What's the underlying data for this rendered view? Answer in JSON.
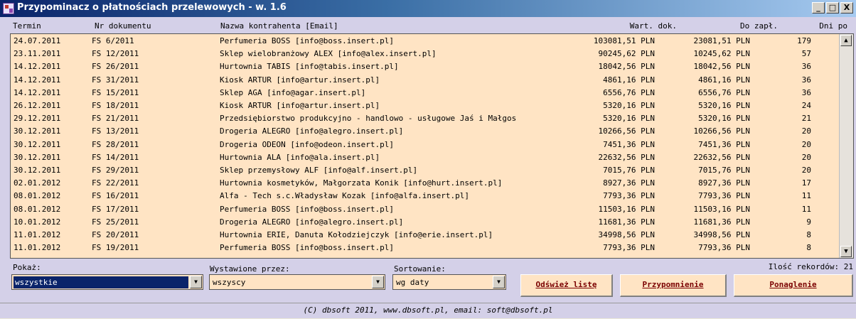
{
  "window": {
    "title": "Przypominacz o płatnościach przelewowych - w. 1.6",
    "min": "_",
    "max": "□",
    "close": "X"
  },
  "columns": {
    "termin": "Termin",
    "nr": "Nr dokumentu",
    "nazwa": "Nazwa kontrahenta [Email]",
    "wart": "Wart. dok.",
    "dozapl": "Do zapł.",
    "dni": "Dni po"
  },
  "rows": [
    [
      "24.07.2011",
      "FS 6/2011",
      "Perfumeria BOSS [info@boss.insert.pl]",
      "103081,51 PLN",
      "23081,51 PLN",
      "179"
    ],
    [
      "23.11.2011",
      "FS 12/2011",
      "Sklep wielobranżowy  ALEX [info@alex.insert.pl]",
      "90245,62 PLN",
      "10245,62 PLN",
      "57"
    ],
    [
      "14.12.2011",
      "FS 26/2011",
      "Hurtownia TABIS [info@tabis.insert.pl]",
      "18042,56 PLN",
      "18042,56 PLN",
      "36"
    ],
    [
      "14.12.2011",
      "FS 31/2011",
      "Kiosk ARTUR [info@artur.insert.pl]",
      "4861,16 PLN",
      "4861,16 PLN",
      "36"
    ],
    [
      "14.12.2011",
      "FS 15/2011",
      "Sklep AGA [info@agar.insert.pl]",
      "6556,76 PLN",
      "6556,76 PLN",
      "36"
    ],
    [
      "26.12.2011",
      "FS 18/2011",
      "Kiosk ARTUR [info@artur.insert.pl]",
      "5320,16 PLN",
      "5320,16 PLN",
      "24"
    ],
    [
      "29.12.2011",
      "FS 21/2011",
      "Przedsiębiorstwo produkcyjno - handlowo - usługowe Jaś i Małgos",
      "5320,16 PLN",
      "5320,16 PLN",
      "21"
    ],
    [
      "30.12.2011",
      "FS 13/2011",
      "Drogeria ALEGRO [info@alegro.insert.pl]",
      "10266,56 PLN",
      "10266,56 PLN",
      "20"
    ],
    [
      "30.12.2011",
      "FS 28/2011",
      "Drogeria ODEON [info@odeon.insert.pl]",
      "7451,36 PLN",
      "7451,36 PLN",
      "20"
    ],
    [
      "30.12.2011",
      "FS 14/2011",
      "Hurtownia ALA [info@ala.insert.pl]",
      "22632,56 PLN",
      "22632,56 PLN",
      "20"
    ],
    [
      "30.12.2011",
      "FS 29/2011",
      "Sklep przemysłowy ALF [info@alf.insert.pl]",
      "7015,76 PLN",
      "7015,76 PLN",
      "20"
    ],
    [
      "02.01.2012",
      "FS 22/2011",
      "Hurtownia kosmetyków, Małgorzata Konik [info@hurt.insert.pl]",
      "8927,36 PLN",
      "8927,36 PLN",
      "17"
    ],
    [
      "08.01.2012",
      "FS 16/2011",
      "Alfa - Tech s.c.Władysław Kozak [info@alfa.insert.pl]",
      "7793,36 PLN",
      "7793,36 PLN",
      "11"
    ],
    [
      "08.01.2012",
      "FS 17/2011",
      "Perfumeria BOSS [info@boss.insert.pl]",
      "11503,16 PLN",
      "11503,16 PLN",
      "11"
    ],
    [
      "10.01.2012",
      "FS 25/2011",
      "Drogeria ALEGRO [info@alegro.insert.pl]",
      "11681,36 PLN",
      "11681,36 PLN",
      "9"
    ],
    [
      "11.01.2012",
      "FS 20/2011",
      "Hurtownia ERIE, Danuta Kołodziejczyk [info@erie.insert.pl]",
      "34998,56 PLN",
      "34998,56 PLN",
      "8"
    ],
    [
      "11.01.2012",
      "FS 19/2011",
      "Perfumeria BOSS [info@boss.insert.pl]",
      "7793,36 PLN",
      "7793,36 PLN",
      "8"
    ]
  ],
  "scroll": {
    "up": "▲",
    "down": "▼"
  },
  "filters": {
    "pokaz_label": "Pokaż:",
    "pokaz_value": "wszystkie",
    "wystawione_label": "Wystawione przez:",
    "wystawione_value": "wszyscy",
    "sort_label": "Sortowanie:",
    "sort_value": "wg daty",
    "dropdown_glyph": "▼"
  },
  "record_count": "Ilość rekordów: 21",
  "buttons": {
    "refresh": "Odśwież listę",
    "remind": "Przypomnienie",
    "urge": "Ponaglenie"
  },
  "footer": "(C) dbsoft 2011, www.dbsoft.pl, email: soft@dbsoft.pl",
  "colors": {
    "list_bg": "#ffe4c4",
    "window_bg": "#d4d0e8",
    "button_text": "#7a0000",
    "selection": "#0a246a"
  }
}
